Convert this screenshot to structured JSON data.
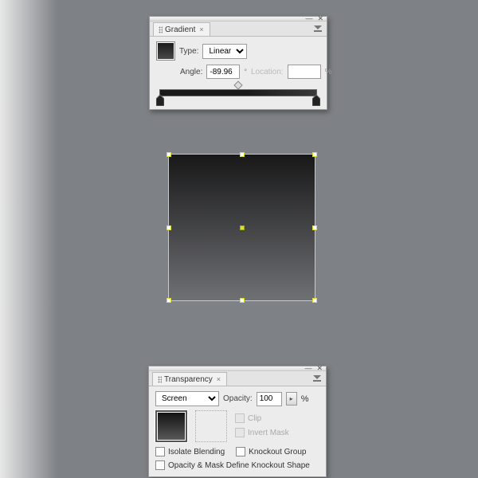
{
  "gradient": {
    "title": "Gradient",
    "type_label": "Type:",
    "type_value": "Linear",
    "angle_label": "Angle:",
    "angle_value": "-89.96",
    "location_label": "Location:",
    "location_value": "",
    "pct": "%"
  },
  "transparency": {
    "title": "Transparency",
    "mode_value": "Screen",
    "opacity_label": "Opacity:",
    "opacity_value": "100",
    "pct": "%",
    "clip_label": "Clip",
    "invert_label": "Invert Mask",
    "isolate_label": "Isolate Blending",
    "knockout_label": "Knockout Group",
    "opmask_label": "Opacity & Mask Define Knockout Shape"
  }
}
